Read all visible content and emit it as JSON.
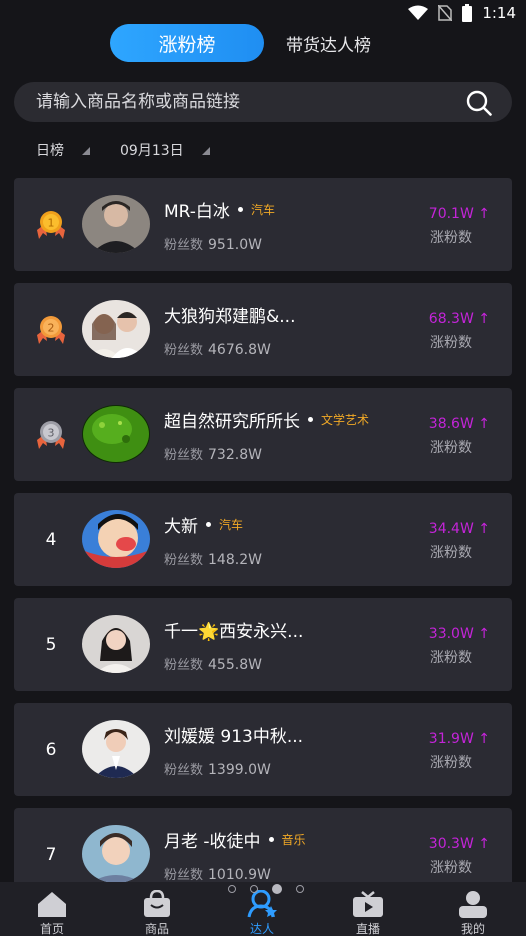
{
  "status": {
    "time": "1:14"
  },
  "tabs": {
    "active": "涨粉榜",
    "inactive": "带货达人榜"
  },
  "search": {
    "placeholder": "请输入商品名称或商品链接"
  },
  "filters": {
    "period": "日榜",
    "date": "09月13日"
  },
  "list": [
    {
      "rank": "1",
      "name": "MR-白冰",
      "tag": "汽车",
      "fans_label": "粉丝数",
      "fans": "951.0W",
      "growth": "70.1W ↑",
      "growth_label": "涨粉数"
    },
    {
      "rank": "2",
      "name": "大狼狗郑建鹏&...",
      "tag": "",
      "fans_label": "粉丝数",
      "fans": "4676.8W",
      "growth": "68.3W ↑",
      "growth_label": "涨粉数"
    },
    {
      "rank": "3",
      "name": "超自然研究所所长",
      "tag": "文学艺术",
      "fans_label": "粉丝数",
      "fans": "732.8W",
      "growth": "38.6W ↑",
      "growth_label": "涨粉数"
    },
    {
      "rank": "4",
      "name": "大新",
      "tag": "汽车",
      "fans_label": "粉丝数",
      "fans": "148.2W",
      "growth": "34.4W ↑",
      "growth_label": "涨粉数"
    },
    {
      "rank": "5",
      "name": "千一🌟西安永兴...",
      "tag": "",
      "fans_label": "粉丝数",
      "fans": "455.8W",
      "growth": "33.0W ↑",
      "growth_label": "涨粉数"
    },
    {
      "rank": "6",
      "name": "刘媛媛 913中秋...",
      "tag": "",
      "fans_label": "粉丝数",
      "fans": "1399.0W",
      "growth": "31.9W ↑",
      "growth_label": "涨粉数"
    },
    {
      "rank": "7",
      "name": "月老 -收徒中",
      "tag": "音乐",
      "fans_label": "粉丝数",
      "fans": "1010.9W",
      "growth": "30.3W ↑",
      "growth_label": "涨粉数"
    }
  ],
  "nav": {
    "home": "首页",
    "goods": "商品",
    "talent": "达人",
    "live": "直播",
    "mine": "我的"
  },
  "colors": {
    "accent": "#2e9cff",
    "growth": "#c324d8",
    "tag": "#f0a826",
    "card": "#2b2b33",
    "bg": "#151519"
  },
  "icons": [
    "wifi-icon",
    "no-sim-icon",
    "battery-icon",
    "search-icon",
    "triangle-icon",
    "medal-gold-icon",
    "medal-silver-icon",
    "medal-bronze-icon",
    "home-icon",
    "bag-icon",
    "talent-icon",
    "tv-icon",
    "user-icon"
  ]
}
